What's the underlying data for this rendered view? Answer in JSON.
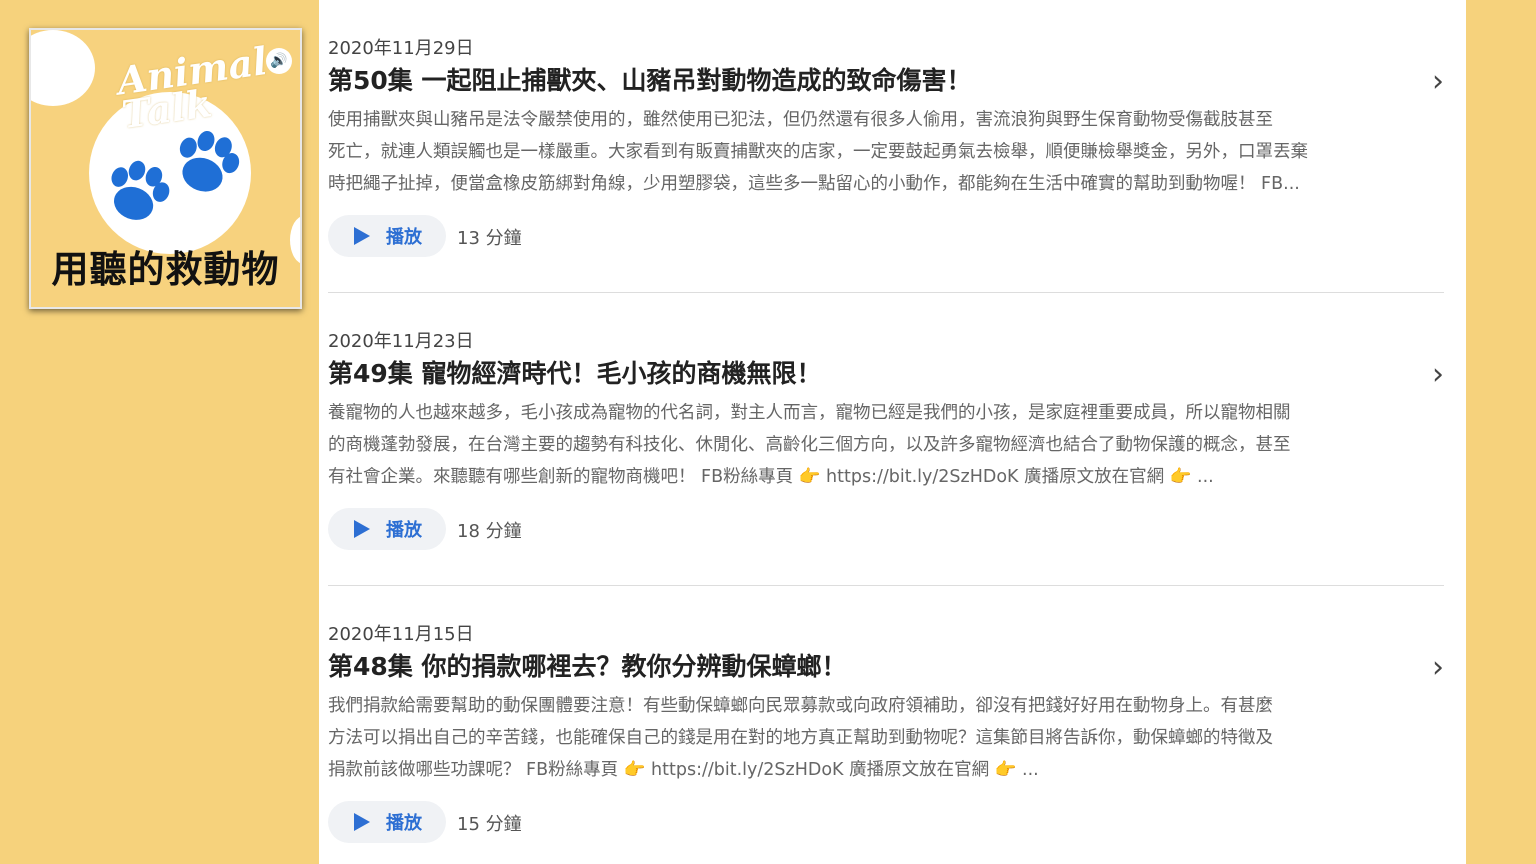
{
  "podcast": {
    "brand": "Animal Talk",
    "title": "用聽的救動物",
    "audio_icon": "speaker-icon"
  },
  "episodes": [
    {
      "date": "2020年11月29日",
      "title": "第50集 一起阻止捕獸夾、山豬吊對動物造成的致命傷害！",
      "desc": [
        "使用捕獸夾與山豬吊是法令嚴禁使用的，雖然使用已犯法，但仍然還有很多人偷用，害流浪狗與野生保育動物受傷截肢甚至",
        "死亡，就連人類誤觸也是一樣嚴重。大家看到有販賣捕獸夾的店家，一定要鼓起勇氣去檢舉，順便賺檢舉獎金，另外，口罩丟棄",
        "時把繩子扯掉，便當盒橡皮筋綁對角線，少用塑膠袋，這些多一點留心的小動作，都能夠在生活中確實的幫助到動物喔！ FB..."
      ],
      "play": "播放",
      "duration": "13 分鐘"
    },
    {
      "date": "2020年11月23日",
      "title": "第49集 寵物經濟時代！毛小孩的商機無限！",
      "desc": [
        "養寵物的人也越來越多，毛小孩成為寵物的代名詞，對主人而言，寵物已經是我們的小孩，是家庭裡重要成員，所以寵物相關",
        "的商機蓬勃發展，在台灣主要的趨勢有科技化、休閒化、高齡化三個方向，以及許多寵物經濟也結合了動物保護的概念，甚至",
        "有社會企業。來聽聽有哪些創新的寵物商機吧！ FB粉絲專頁 👉 https://bit.ly/2SzHDoK 廣播原文放在官網 👉 ..."
      ],
      "play": "播放",
      "duration": "18 分鐘"
    },
    {
      "date": "2020年11月15日",
      "title": "第48集 你的捐款哪裡去？教你分辨動保蟑螂！",
      "desc": [
        "我們捐款給需要幫助的動保團體要注意！有些動保蟑螂向民眾募款或向政府領補助，卻沒有把錢好好用在動物身上。有甚麼",
        "方法可以捐出自己的辛苦錢，也能確保自己的錢是用在對的地方真正幫助到動物呢？這集節目將告訴你，動保蟑螂的特徵及",
        "捐款前該做哪些功課呢？ FB粉絲專頁 👉 https://bit.ly/2SzHDoK 廣播原文放在官網 👉 ..."
      ],
      "play": "播放",
      "duration": "15 分鐘"
    }
  ],
  "colors": {
    "background": "#f6d27c",
    "accent": "#2d6fd3",
    "paw": "#1f6fd6"
  }
}
